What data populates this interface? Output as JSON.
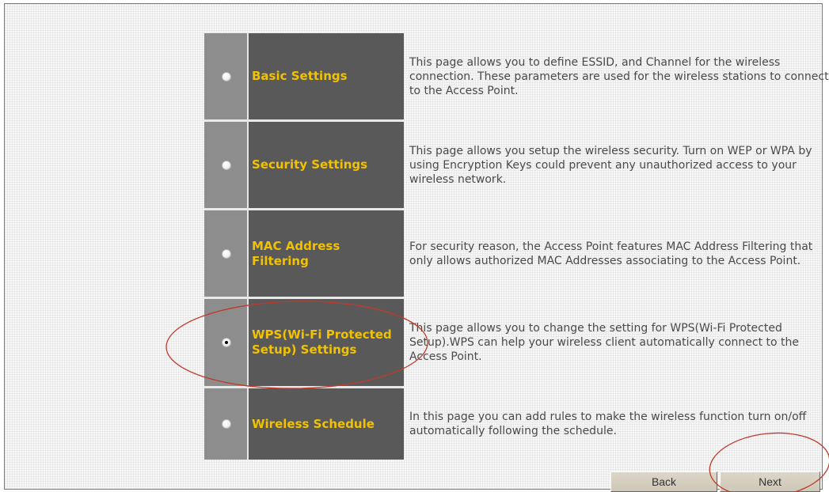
{
  "options": [
    {
      "label": "Basic Settings",
      "description": "This page allows you to define ESSID, and Channel for the wireless connection. These parameters are used for the wireless stations to connect to the Access Point.",
      "selected": false
    },
    {
      "label": "Security Settings",
      "description": "This page allows you setup the wireless security. Turn on WEP or WPA by using Encryption Keys could prevent any unauthorized access to your wireless network.",
      "selected": false
    },
    {
      "label": "MAC Address Filtering",
      "description": "For security reason, the Access Point features MAC Address Filtering that only allows authorized MAC Addresses associating to the Access Point.",
      "selected": false
    },
    {
      "label": "WPS(Wi-Fi Protected Setup) Settings",
      "description": "This page allows you to change the setting for WPS(Wi-Fi Protected Setup).WPS can help your wireless client automatically connect to the Access Point.",
      "selected": true
    },
    {
      "label": "Wireless Schedule",
      "description": "In this page you can add rules to make the wireless function turn on/off automatically following the schedule.",
      "selected": false
    }
  ],
  "buttons": {
    "back_label": "Back",
    "next_label": "Next"
  },
  "colors": {
    "label_bg": "#595959",
    "radio_bg": "#8d8d8d",
    "label_text": "#f2c200",
    "annotation": "#c0392b"
  }
}
